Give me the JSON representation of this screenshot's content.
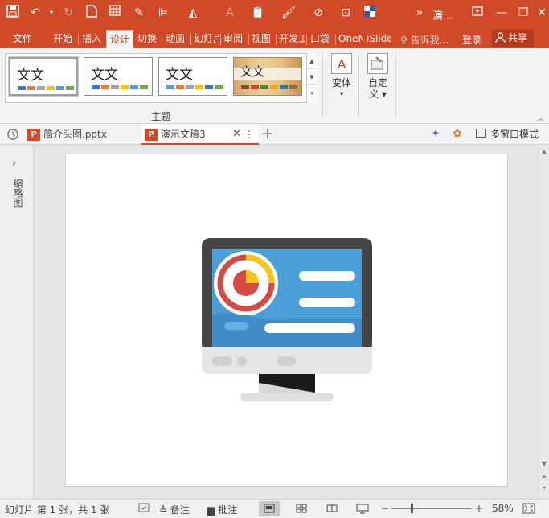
{
  "title_bar": {
    "doc_title": "演...",
    "quick_access": [
      "save-icon",
      "undo-icon",
      "redo-icon",
      "new-file-icon",
      "table-icon",
      "eyedropper-icon",
      "align-icon",
      "fill-icon",
      "font-color-icon",
      "paste-icon",
      "format-painter-icon",
      "shape-icon",
      "screenshot-icon",
      "color-icon",
      "more-icon"
    ],
    "window_controls": [
      "ribbon-display-icon",
      "minimize-icon",
      "restore-icon",
      "close-icon"
    ]
  },
  "ribbon_tabs": [
    "文件",
    "开始",
    "插入",
    "设计",
    "切换",
    "动画",
    "幻灯片",
    "审阅",
    "视图",
    "开发工具",
    "口袋",
    "OneNote",
    "iSlide"
  ],
  "active_tab": "设计",
  "tell_me": "告诉我...",
  "login": "登录",
  "share": "共享",
  "themes": {
    "group_label": "主题",
    "items": [
      {
        "label": "文文",
        "colors": [
          "#4472c4",
          "#ed7d31",
          "#a5a5a5",
          "#ffc000",
          "#5b9bd5",
          "#70ad47"
        ]
      },
      {
        "label": "文文",
        "colors": [
          "#4472c4",
          "#ed7d31",
          "#a5a5a5",
          "#ffc000",
          "#5b9bd5",
          "#70ad47"
        ]
      },
      {
        "label": "文文",
        "colors": [
          "#5b9bd5",
          "#ed7d31",
          "#a5a5a5",
          "#ffc000",
          "#4472c4",
          "#70ad47"
        ]
      },
      {
        "label": "文文",
        "colors": [
          "#7a5230",
          "#d04a28",
          "#4e8542",
          "#e8a530",
          "#2e6f9e",
          "#8e6c4a"
        ]
      }
    ]
  },
  "variants": {
    "label": "变体"
  },
  "customize": {
    "label_line1": "自定",
    "label_line2": "义"
  },
  "doc_tabs": [
    {
      "name": "简介头图.pptx",
      "active": false
    },
    {
      "name": "演示文稿3",
      "active": true
    }
  ],
  "multi_window": "多窗口模式",
  "side_pane_label": "缩略图",
  "status": {
    "slide_info": "幻灯片 第 1 张，共 1 张",
    "notes": "备注",
    "comments": "批注",
    "zoom": "58%",
    "zoom_fraction": 0.58
  },
  "colors": {
    "accent": "#d04a28",
    "screen_blue": "#4a9fd8",
    "monitor_dark": "#444444",
    "monitor_base": "#e5e5e5",
    "chart_red": "#d44a45",
    "chart_yellow": "#f5c518"
  }
}
